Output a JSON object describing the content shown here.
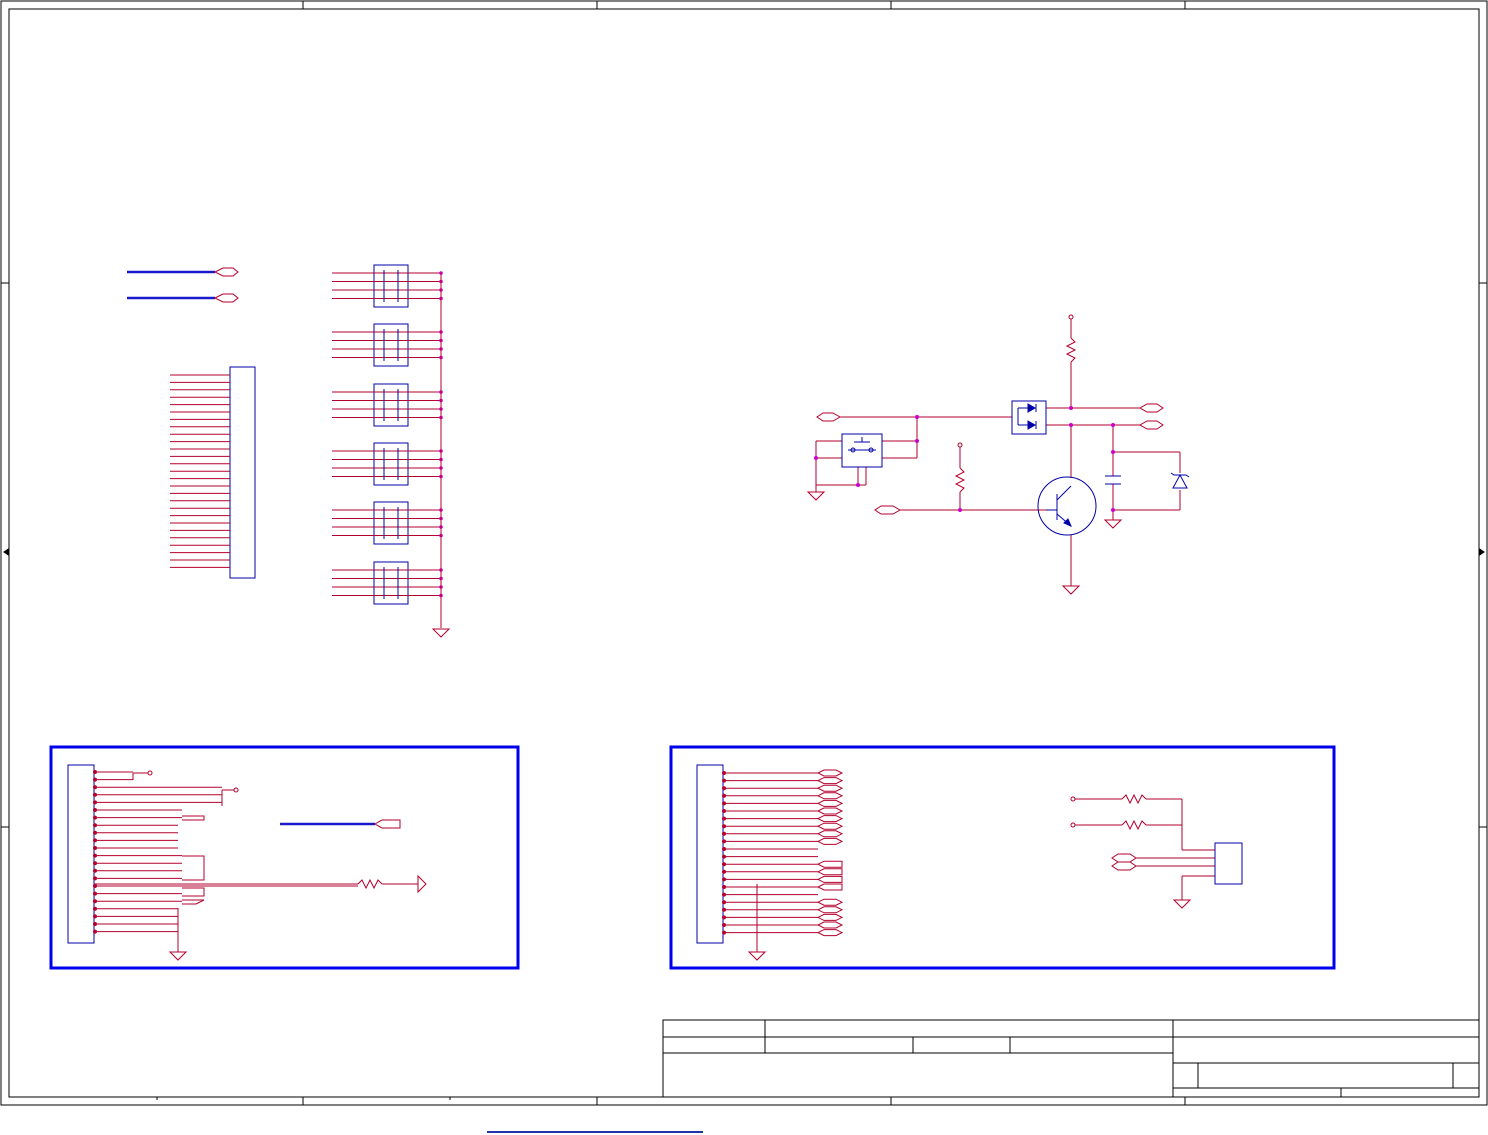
{
  "sheet": {
    "border_color": "#000000",
    "wire_color": "#b3002d",
    "bus_color": "#1a1acc",
    "junction_color": "#cc00cc",
    "component_color": "#0000aa",
    "highlight_box_color": "#0000ee"
  },
  "icons": [
    "ground-symbol",
    "power-pin",
    "resistor",
    "capacitor",
    "diode",
    "zener-diode",
    "transistor",
    "push-switch",
    "connector",
    "net-port",
    "rj45-connector"
  ],
  "title_block": {
    "cells": []
  }
}
